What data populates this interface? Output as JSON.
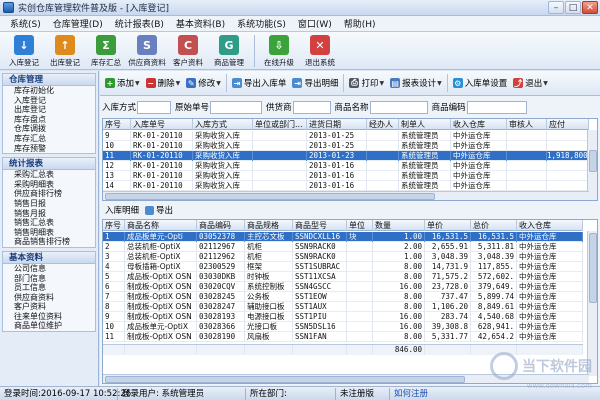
{
  "window": {
    "title": "实创仓库管理软件普及版 - [入库登记]"
  },
  "menu": [
    "系统(S)",
    "仓库管理(D)",
    "统计报表(B)",
    "基本资料(B)",
    "系统功能(S)",
    "窗口(W)",
    "帮助(H)"
  ],
  "toolbar": [
    {
      "label": "入库登记",
      "icon": "inbound-icon",
      "color": "#2f7fd6",
      "glyph": "↓"
    },
    {
      "label": "出库登记",
      "icon": "outbound-icon",
      "color": "#e08a1e",
      "glyph": "↑"
    },
    {
      "label": "库存汇总",
      "icon": "stock-summary-icon",
      "color": "#3a9c3a",
      "glyph": "Σ"
    },
    {
      "label": "供应商资料",
      "icon": "supplier-icon",
      "color": "#6a7fbf",
      "glyph": "S"
    },
    {
      "label": "客户资料",
      "icon": "customer-icon",
      "color": "#c25050",
      "glyph": "C"
    },
    {
      "label": "商品管理",
      "icon": "goods-icon",
      "color": "#2e9c86",
      "glyph": "G"
    },
    {
      "label": "在线升级",
      "icon": "update-icon",
      "color": "#3aa33a",
      "glyph": "⇩"
    },
    {
      "label": "退出系统",
      "icon": "exit-icon",
      "color": "#d24040",
      "glyph": "✕"
    }
  ],
  "sidebar": [
    {
      "title": "仓库管理",
      "items": [
        "库存初始化",
        "入库登记",
        "出库登记",
        "库存盘点",
        "仓库调拨",
        "库存汇总",
        "库存预警"
      ]
    },
    {
      "title": "统计报表",
      "items": [
        "采购汇总表",
        "采购明细表",
        "供应商排行榜",
        "销售日报",
        "销售月报",
        "销售汇总表",
        "销售明细表",
        "商品销售排行榜"
      ]
    },
    {
      "title": "基本资料",
      "items": [
        "公司信息",
        "部门信息",
        "员工信息",
        "供应商资料",
        "客户资料",
        "往来单位资料",
        "商品单位维护"
      ]
    }
  ],
  "actions": [
    {
      "label": "添加",
      "icon": "add-icon",
      "color": "#2e9a2e",
      "glyph": "+",
      "dd": true
    },
    {
      "label": "删除",
      "icon": "delete-icon",
      "color": "#c33",
      "glyph": "−",
      "dd": true
    },
    {
      "label": "修改",
      "icon": "edit-icon",
      "color": "#3a6fc4",
      "glyph": "✎",
      "dd": true
    },
    {
      "label": "导出入库单",
      "icon": "export-receipt-icon",
      "color": "#4b8bd0",
      "glyph": "⇥",
      "dd": false
    },
    {
      "label": "导出明细",
      "icon": "export-detail-icon",
      "color": "#4b8bd0",
      "glyph": "⇥",
      "dd": false
    },
    {
      "label": "打印",
      "icon": "print-icon",
      "color": "#556",
      "glyph": "⎙",
      "dd": true
    },
    {
      "label": "报表设计",
      "icon": "report-design-icon",
      "color": "#4a7ac0",
      "glyph": "▤",
      "dd": true
    },
    {
      "label": "入库单设置",
      "icon": "settings-icon",
      "color": "#2a8fd0",
      "glyph": "⚙",
      "dd": false
    },
    {
      "label": "退出",
      "icon": "exit-icon",
      "color": "#d24040",
      "glyph": "⤴",
      "dd": true
    }
  ],
  "filters": [
    "入库方式",
    "原始单号",
    "供货商",
    "商品名称",
    "商品编码"
  ],
  "top_table": {
    "columns": [
      "序号",
      "入库单号",
      "入库方式",
      "单位或部门...",
      "进货日期",
      "经办人",
      "制单人",
      "收入仓库",
      "审核人",
      "应付"
    ],
    "rows": [
      [
        "9",
        "RK-01-20110",
        "采购收货入库",
        "",
        "2013-01-25",
        "",
        "系统管理员",
        "中外运仓库",
        "",
        ""
      ],
      [
        "10",
        "RK-01-20110",
        "采购收货入库",
        "",
        "2013-01-25",
        "",
        "系统管理员",
        "中外运仓库",
        "",
        ""
      ],
      [
        "11",
        "RK-01-20110",
        "采购收货入库",
        "",
        "2013-01-23",
        "",
        "系统管理员",
        "中外运仓库",
        "",
        "1,918,800"
      ],
      [
        "12",
        "RK-01-20110",
        "采购收货入库",
        "",
        "2013-01-16",
        "",
        "系统管理员",
        "中外运仓库",
        "",
        ""
      ],
      [
        "13",
        "RK-01-20110",
        "采购收货入库",
        "",
        "2013-01-16",
        "",
        "系统管理员",
        "中外运仓库",
        "",
        ""
      ],
      [
        "14",
        "RK-01-20110",
        "采购收货入库",
        "",
        "2013-01-16",
        "",
        "系统管理员",
        "中外运仓库",
        "",
        ""
      ]
    ]
  },
  "detail_tabs": {
    "tab": "入库明细",
    "export": "导出"
  },
  "bottom_table": {
    "columns": [
      "序号",
      "商品名称",
      "商品编码",
      "商品规格",
      "商品型号",
      "单位",
      "数量",
      "单价",
      "总价",
      "收入仓库"
    ],
    "rows": [
      [
        "1",
        "成品板单元-Opti",
        "03052378",
        "主控芯文板",
        "SSNDCXLL16",
        "块",
        "1.00",
        "16,531.5",
        "16,531.5",
        "中外运仓库"
      ],
      [
        "2",
        "总装机柜-OptiX",
        "02112967",
        "机柜",
        "SSN9RACK0",
        "",
        "2.00",
        "2,655.91",
        "5,311.81",
        "中外运仓库"
      ],
      [
        "3",
        "总装机柜-OptiX",
        "02112962",
        "机柜",
        "SSN9RACK0",
        "",
        "1.00",
        "3,048.39",
        "3,048.39",
        "中外运仓库"
      ],
      [
        "4",
        "母板插箱-OptiX",
        "02300529",
        "框架",
        "SST1SUBRAC",
        "",
        "8.00",
        "14,731.9",
        "117,855.",
        "中外运仓库"
      ],
      [
        "5",
        "成品板-OptiX OSN",
        "03030DKB",
        "时钟板",
        "SST11XCSA",
        "",
        "8.00",
        "71,575.2",
        "572,602.",
        "中外运仓库"
      ],
      [
        "6",
        "制成板-OptiX OSN",
        "03020CQV",
        "系统控制板",
        "SSN4GSCC",
        "",
        "16.00",
        "23,728.0",
        "379,649.",
        "中外运仓库"
      ],
      [
        "7",
        "制成板-OptiX OSN",
        "03028245",
        "公务板",
        "SST1EOW",
        "",
        "8.00",
        "737.47",
        "5,899.74",
        "中外运仓库"
      ],
      [
        "8",
        "制成板-OptiX OSN",
        "03028247",
        "辅助接口板",
        "SST1AUX",
        "",
        "8.00",
        "1,106.20",
        "8,849.61",
        "中外运仓库"
      ],
      [
        "9",
        "制成板-OptiX OSN",
        "03028193",
        "电源接口板",
        "SST1PIU",
        "",
        "16.00",
        "283.74",
        "4,540.68",
        "中外运仓库"
      ],
      [
        "10",
        "成品板单元-OptiX",
        "03028366",
        "光接口板",
        "SSN5DSL16",
        "",
        "16.00",
        "39,308.8",
        "628,941.",
        "中外运仓库"
      ],
      [
        "11",
        "制成板-OptiX OSN",
        "03028190",
        "风扇板",
        "SSN1FAN",
        "",
        "8.00",
        "5,331.77",
        "42,654.2",
        "中外运仓库"
      ]
    ],
    "total_qty": "846.00"
  },
  "status": {
    "login_time": "登录时间:2016-09-17 10:52:26",
    "login_user": "登录用户: 系统管理员",
    "dept_label": "所在部门:",
    "reg": "未注册版",
    "reg_link": "如何注册"
  },
  "watermark": {
    "brand": "当下软件园",
    "url": "www.downxia.com"
  }
}
